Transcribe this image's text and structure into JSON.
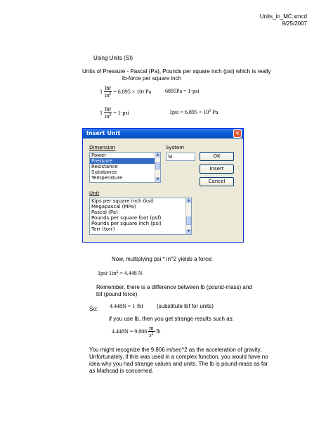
{
  "header": {
    "filename": "Units_in_MC.xmcd",
    "date": "9/25/2007"
  },
  "section_title": "Using Units (SI)",
  "pressure_line1": "Units of Pressure  - Pascal (Pa), Pounds per square inch (psi) which is really",
  "pressure_line2": "lb-force per square inch",
  "eq1": {
    "lead": "1",
    "num": "lbf",
    "den_base": "in",
    "den_exp": "2",
    "rhs": "= 6.895 × 10",
    "exp": "3",
    "unit": "Pa"
  },
  "eq2": {
    "text": "6895Pa = 1·psi"
  },
  "eq3": {
    "lead": "1",
    "num": "lbf",
    "den_base": "in",
    "den_exp": "2",
    "rhs": "= 1·psi"
  },
  "eq4": {
    "text": "1psi = 6.895 × 10",
    "exp": "3",
    "unit": "Pa"
  },
  "dialog": {
    "title": "Insert Unit",
    "close": "✕",
    "dimension_label": "Dimension",
    "system_label": "System",
    "system_value": "SI",
    "dimension_items": [
      "Power",
      "Pressure",
      "Resistance",
      "Substance",
      "Temperature"
    ],
    "selected_dimension": "Pressure",
    "unit_label": "Unit",
    "unit_items": [
      "Kips per square inch (ksi)",
      "Megapascal (MPa)",
      "Pascal (Pa)",
      "Pounds per square foot (psf)",
      "Pounds per square inch (psi)",
      "Torr (torr)"
    ],
    "ok": "OK",
    "insert": "Insert",
    "cancel": "Cancel"
  },
  "force_line": "Now, multiplying psi * in^2 yields a force:",
  "eq5": {
    "text": "1psi·1in",
    "exp": "2",
    "rhs": " = 4.448 N"
  },
  "remember1": "Remember, there is a difference between lb (pound-mass) and",
  "remember2": "lbf (pound force)",
  "so_label": "So:",
  "eq6": {
    "text": "4.448N = 1·lbf"
  },
  "subst_note": "(substitute lbf for units)",
  "if_line": "if you use lb, then you get strange results such as:",
  "eq7": {
    "lead": "4.448N = 9.806",
    "num": "m",
    "den_base": "s",
    "den_exp": "2",
    "tail": "·lb"
  },
  "closing": [
    "You might recognize the 9.806 m/sec^2 as the acceleration of gravity.",
    "Unfortunately, if this was used in a complex function, you would have no",
    "idea why you had strange values and units.  The lb is pound-mass as far",
    "as Mathcad is concerned."
  ]
}
